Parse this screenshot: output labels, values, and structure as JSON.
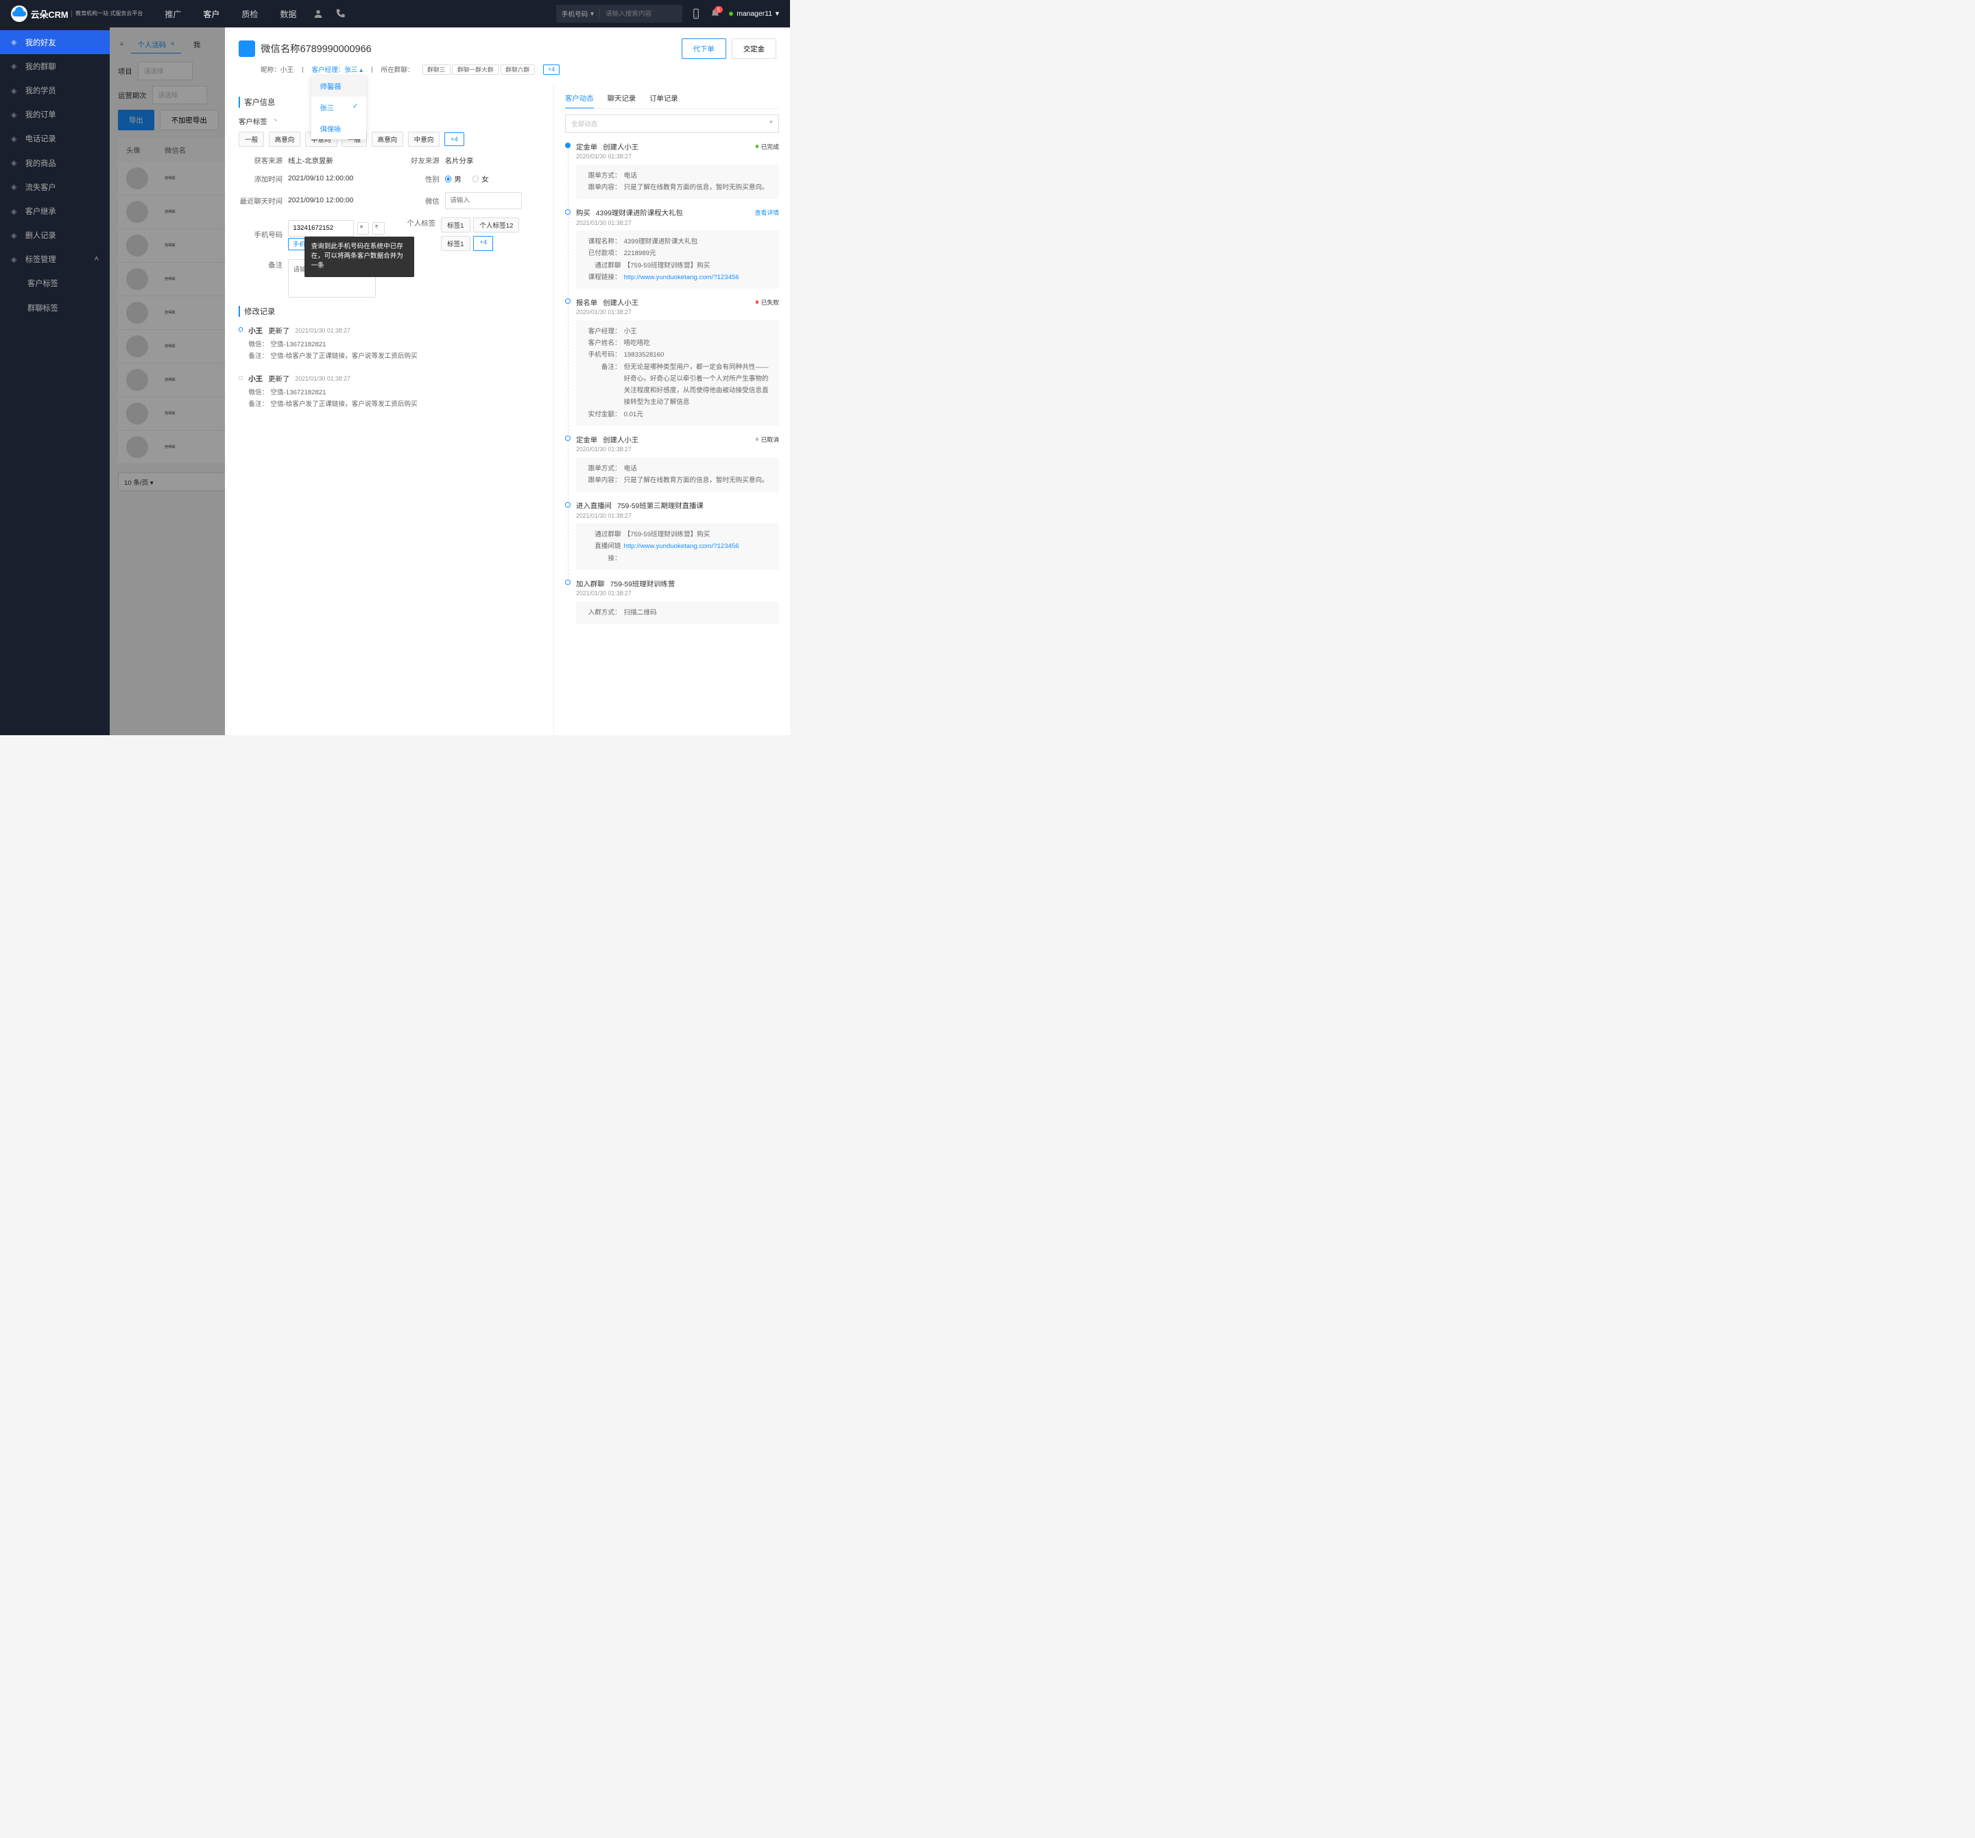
{
  "topbar": {
    "logo_text": "云朵CRM",
    "logo_sub": "教育机构一站\n式服务云平台",
    "nav": [
      "推广",
      "客户",
      "质检",
      "数据"
    ],
    "nav_active": 1,
    "search_type": "手机号码",
    "search_placeholder": "请输入搜索内容",
    "badge_count": "5",
    "username": "manager11"
  },
  "sidebar": {
    "items": [
      {
        "icon": "user",
        "label": "我的好友",
        "active": true
      },
      {
        "icon": "group",
        "label": "我的群聊"
      },
      {
        "icon": "filter",
        "label": "我的学员"
      },
      {
        "icon": "order",
        "label": "我的订单"
      },
      {
        "icon": "phone",
        "label": "电话记录"
      },
      {
        "icon": "goods",
        "label": "我的商品"
      },
      {
        "icon": "lost",
        "label": "流失客户"
      },
      {
        "icon": "inherit",
        "label": "客户继承"
      },
      {
        "icon": "record",
        "label": "删人记录"
      },
      {
        "icon": "tag",
        "label": "标签管理",
        "expanded": true
      }
    ],
    "sub_items": [
      "客户标签",
      "群聊标签"
    ]
  },
  "background": {
    "tab_label": "个人活码",
    "other_tab": "我",
    "filter1_label": "项目",
    "filter2_label": "运营期次",
    "filter_placeholder": "请选择",
    "export_btn": "导出",
    "unencrypt_btn": "不加密导出",
    "th_avatar": "头像",
    "th_name": "微信名",
    "row_name": "自得其",
    "page_size": "10 条/页"
  },
  "panel": {
    "title": "微信名称6789990000966",
    "place_order_btn": "代下单",
    "deposit_btn": "交定金",
    "nickname_label": "昵称：",
    "nickname": "小王",
    "manager_label": "客户经理：",
    "manager": "张三",
    "groups_label": "所在群聊：",
    "groups": [
      "群聊三",
      "群聊一群大群",
      "群聊六群"
    ],
    "groups_more": "+4",
    "manager_options": [
      "师馨薇",
      "张三",
      "佴保咏"
    ],
    "manager_selected_idx": 1,
    "info_section": "客户信息",
    "tag_label": "客户标签",
    "tags": [
      "一般",
      "高意向",
      "中意向",
      "一般",
      "高意向",
      "中意向"
    ],
    "tags_more": "+4",
    "fields": {
      "source_label": "获客来源",
      "source": "线上-北京昱新",
      "friend_label": "好友来源",
      "friend": "名片分享",
      "add_time_label": "添加时间",
      "add_time": "2021/09/10 12:00:00",
      "gender_label": "性别",
      "gender_m": "男",
      "gender_f": "女",
      "last_chat_label": "最近聊天时间",
      "last_chat": "2021/09/10 12:00:00",
      "wechat_label": "微信",
      "wechat_placeholder": "请输入",
      "phone_label": "手机号码",
      "phone": "13241672152",
      "phone_tag": "手机",
      "personal_tag_label": "个人标签",
      "ptags": [
        "标签1",
        "个人标签12",
        "标签1"
      ],
      "ptags_more": "+4",
      "remark_label": "备注",
      "remark_placeholder": "请输入备注内容"
    },
    "tooltip": "查询到此手机号码在系统中已存在，可以将两条客户数据合并为一条",
    "history_section": "修改记录",
    "history": [
      {
        "dot": "blue",
        "who": "小王",
        "action": "更新了",
        "time": "2021/01/30   01:38:27",
        "lines": [
          {
            "label": "微信：",
            "text": "空值-13672182821"
          },
          {
            "label": "备注：",
            "text": "空值-给客户发了正课链接，客户说等发工资后购买"
          }
        ]
      },
      {
        "dot": "gray",
        "who": "小王",
        "action": "更新了",
        "time": "2021/01/30   01:38:27",
        "lines": [
          {
            "label": "微信：",
            "text": "空值-13672182821"
          },
          {
            "label": "备注：",
            "text": "空值-给客户发了正课链接，客户说等发工资后购买"
          }
        ]
      }
    ]
  },
  "right": {
    "tabs": [
      "客户动态",
      "聊天记录",
      "订单记录"
    ],
    "active_tab": 0,
    "filter": "全部动态",
    "timeline": [
      {
        "dot": "solid",
        "title": "定金单",
        "sub": "创建人小王",
        "status": "已完成",
        "status_color": "#52c41a",
        "time": "2020/01/30   01:38:27",
        "card": [
          {
            "label": "跟单方式：",
            "text": "电话"
          },
          {
            "label": "跟单内容：",
            "text": "只是了解在线教育方面的信息，暂时无购买意向。"
          }
        ]
      },
      {
        "dot": "hollow",
        "title": "购买",
        "sub": "4399理财课进阶课程大礼包",
        "link": "查看详情",
        "time": "2021/01/30   01:38:27",
        "card": [
          {
            "label": "课程名称：",
            "text": "4399理财课进阶课大礼包"
          },
          {
            "label": "已付款项：",
            "text": "2218989元"
          },
          {
            "label": "通过群聊",
            "text": "【759-59班理财训练营】购买"
          },
          {
            "label": "课程链接：",
            "text": "http://www.yunduoketang.com/?123456",
            "is_link": true
          }
        ]
      },
      {
        "dot": "hollow",
        "title": "报名单",
        "sub": "创建人小王",
        "status": "已失败",
        "status_color": "#ff4d4f",
        "time": "2020/01/30   01:38:27",
        "card": [
          {
            "label": "客户经理：",
            "text": "小王"
          },
          {
            "label": "客户姓名：",
            "text": "唔吃唔吃"
          },
          {
            "label": "手机号码：",
            "text": "19833528160"
          },
          {
            "label": "备注：",
            "text": "但无论是哪种类型用户，都一定会有同种共性——好奇心。好奇心足以牵引着一个人对所产生事物的关注程度和好感度，从而使得他由被动接受信息直接转型为主动了解信息"
          },
          {
            "label": "实付金额：",
            "text": "0.01元"
          }
        ]
      },
      {
        "dot": "hollow",
        "title": "定金单",
        "sub": "创建人小王",
        "status": "已取消",
        "status_color": "#bbb",
        "time": "2020/01/30   01:38:27",
        "card": [
          {
            "label": "跟单方式：",
            "text": "电话"
          },
          {
            "label": "跟单内容：",
            "text": "只是了解在线教育方面的信息，暂时无购买意向。"
          }
        ]
      },
      {
        "dot": "hollow",
        "title": "进入直播间",
        "sub": "759-59班第三期理财直播课",
        "time": "2021/01/30   01:38:27",
        "card": [
          {
            "label": "通过群聊",
            "text": "【759-59班理财训练营】购买"
          },
          {
            "label": "直播间链接：",
            "text": "http://www.yunduoketang.com/?123456",
            "is_link": true
          }
        ]
      },
      {
        "dot": "hollow",
        "title": "加入群聊",
        "sub": "759-59班理财训练营",
        "time": "2021/01/30   01:38:27",
        "card": [
          {
            "label": "入群方式：",
            "text": "扫描二维码"
          }
        ]
      }
    ]
  }
}
